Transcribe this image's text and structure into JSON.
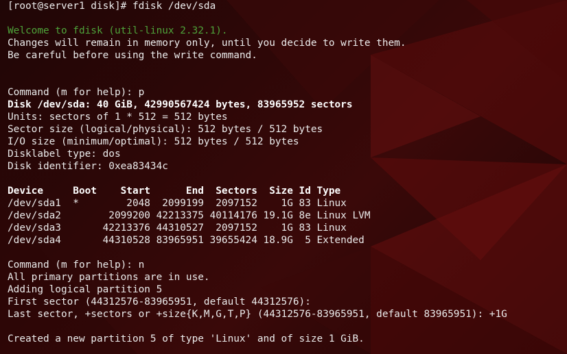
{
  "colors": {
    "background": "#2a0606",
    "text": "#ececec",
    "welcome_green": "#4ea33a"
  },
  "terminal": {
    "lines": [
      {
        "text": "[root@server1 disk]# fdisk /dev/sda",
        "style": "normal"
      },
      {
        "text": "",
        "style": "blank"
      },
      {
        "text": "Welcome to fdisk (util-linux 2.32.1).",
        "style": "green"
      },
      {
        "text": "Changes will remain in memory only, until you decide to write them.",
        "style": "normal"
      },
      {
        "text": "Be careful before using the write command.",
        "style": "normal"
      },
      {
        "text": "",
        "style": "blank"
      },
      {
        "text": "",
        "style": "blank"
      },
      {
        "text": "Command (m for help): p",
        "style": "normal"
      },
      {
        "text": "Disk /dev/sda: 40 GiB, 42990567424 bytes, 83965952 sectors",
        "style": "bold"
      },
      {
        "text": "Units: sectors of 1 * 512 = 512 bytes",
        "style": "normal"
      },
      {
        "text": "Sector size (logical/physical): 512 bytes / 512 bytes",
        "style": "normal"
      },
      {
        "text": "I/O size (minimum/optimal): 512 bytes / 512 bytes",
        "style": "normal"
      },
      {
        "text": "Disklabel type: dos",
        "style": "normal"
      },
      {
        "text": "Disk identifier: 0xea83434c",
        "style": "normal"
      },
      {
        "text": "",
        "style": "blank"
      },
      {
        "text": "Device     Boot    Start      End  Sectors  Size Id Type",
        "style": "bold"
      },
      {
        "text": "/dev/sda1  *        2048  2099199  2097152    1G 83 Linux",
        "style": "normal"
      },
      {
        "text": "/dev/sda2        2099200 42213375 40114176 19.1G 8e Linux LVM",
        "style": "normal"
      },
      {
        "text": "/dev/sda3       42213376 44310527  2097152    1G 83 Linux",
        "style": "normal"
      },
      {
        "text": "/dev/sda4       44310528 83965951 39655424 18.9G  5 Extended",
        "style": "normal"
      },
      {
        "text": "",
        "style": "blank"
      },
      {
        "text": "Command (m for help): n",
        "style": "normal"
      },
      {
        "text": "All primary partitions are in use.",
        "style": "normal"
      },
      {
        "text": "Adding logical partition 5",
        "style": "normal"
      },
      {
        "text": "First sector (44312576-83965951, default 44312576):",
        "style": "normal"
      },
      {
        "text": "Last sector, +sectors or +size{K,M,G,T,P} (44312576-83965951, default 83965951): +1G",
        "style": "normal"
      },
      {
        "text": "",
        "style": "blank"
      },
      {
        "text": "Created a new partition 5 of type 'Linux' and of size 1 GiB.",
        "style": "normal"
      }
    ]
  }
}
